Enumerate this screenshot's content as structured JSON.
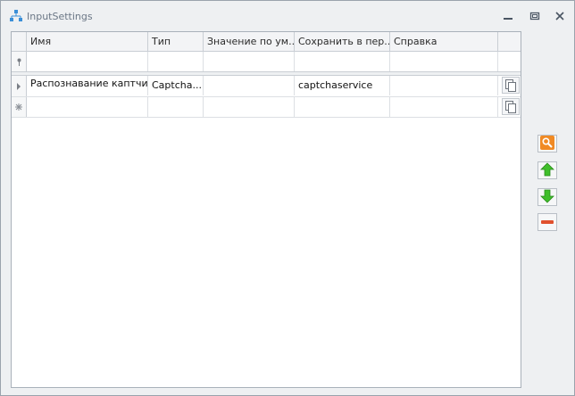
{
  "window": {
    "title": "InputSettings",
    "icons": {
      "app": "tree-icon",
      "minimize": "minimize-icon",
      "restore": "restore-icon",
      "close": "close-icon"
    }
  },
  "grid": {
    "columns": [
      "Имя",
      "Тип",
      "Значение по ум...",
      "Сохранить в пер...",
      "Справка"
    ],
    "filter_row": {
      "icon": "filter-icon"
    },
    "rows": [
      {
        "name": "Распознавание каптчи:",
        "type": "Captcha...",
        "default": "",
        "save_to": "captchaservice",
        "help": ""
      }
    ],
    "new_row": {
      "icon": "new-row-asterisk-icon"
    }
  },
  "side_buttons": [
    {
      "name": "search",
      "icon": "magnifier-icon",
      "color": "#f08a24"
    },
    {
      "name": "move-up",
      "icon": "arrow-up-icon",
      "color": "#3fbf2a"
    },
    {
      "name": "move-down",
      "icon": "arrow-down-icon",
      "color": "#3fbf2a"
    },
    {
      "name": "remove",
      "icon": "minus-icon",
      "color": "#e0502d"
    }
  ]
}
